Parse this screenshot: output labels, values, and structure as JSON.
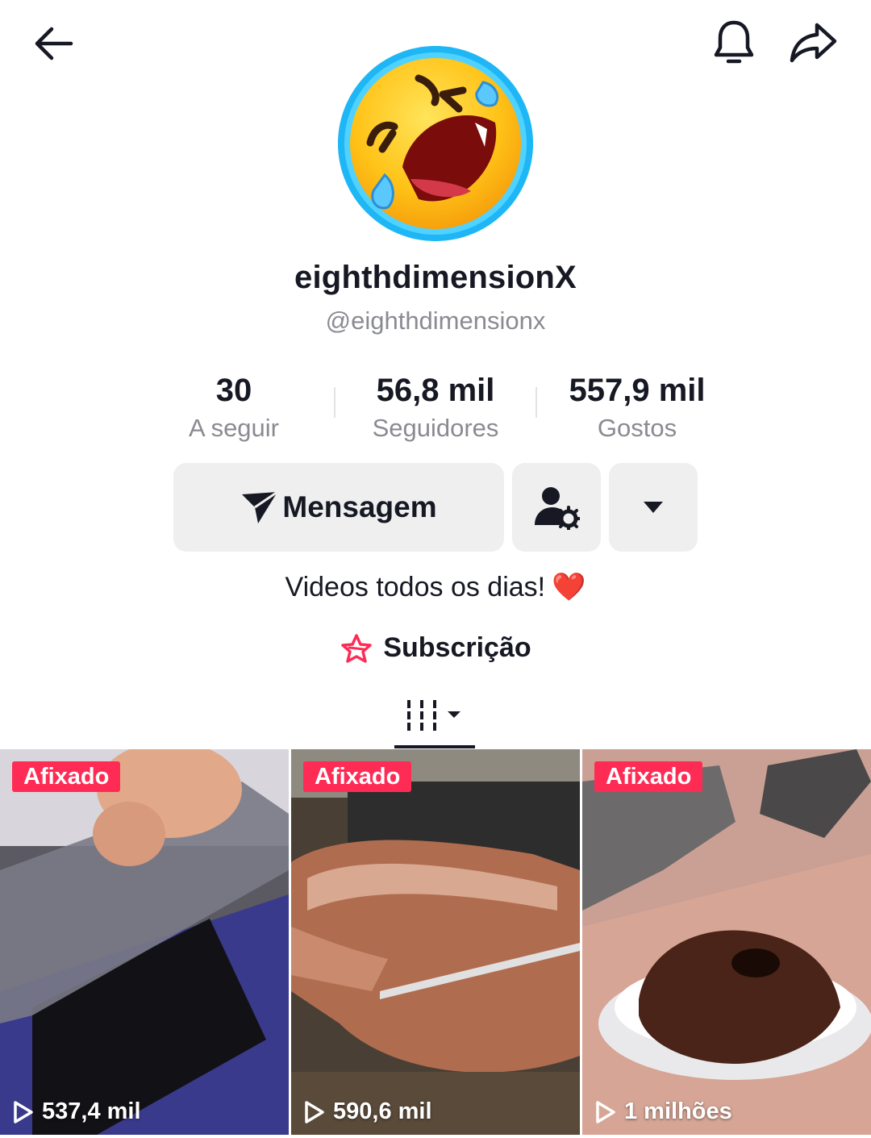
{
  "topbar": {
    "back_icon": "arrow-left-icon",
    "bell_icon": "bell-icon",
    "share_icon": "share-arrow-icon"
  },
  "profile": {
    "avatar_icon": "laughing-crying-emoji",
    "display_name": "eighthdimensionX",
    "handle": "@eighthdimensionx",
    "bio": "Videos todos os dias!",
    "bio_emoji": "❤️"
  },
  "stats": [
    {
      "value": "30",
      "label": "A seguir"
    },
    {
      "value": "56,8 mil",
      "label": "Seguidores"
    },
    {
      "value": "557,9 mil",
      "label": "Gostos"
    }
  ],
  "actions": {
    "message_label": "Mensagem",
    "message_icon": "send-arrow-icon",
    "friend_icon": "user-gear-icon",
    "more_icon": "caret-down-icon"
  },
  "subscription": {
    "label": "Subscrição",
    "icon": "star-outline-icon",
    "icon_color": "#fe2c55"
  },
  "tabs": {
    "videos_icon": "grid-columns-icon"
  },
  "videos": [
    {
      "pinned_label": "Afixado",
      "views": "537,4 mil",
      "thumbnail": "phone screen cutting"
    },
    {
      "pinned_label": "Afixado",
      "views": "590,6 mil",
      "thumbnail": "meat skewer carving"
    },
    {
      "pinned_label": "Afixado",
      "views": "1 milhões",
      "thumbnail": "chocolate cake"
    }
  ],
  "colors": {
    "accent": "#fe2c55",
    "text": "#161823",
    "secondary_text": "#8a8b91",
    "button_bg": "#efefef"
  }
}
